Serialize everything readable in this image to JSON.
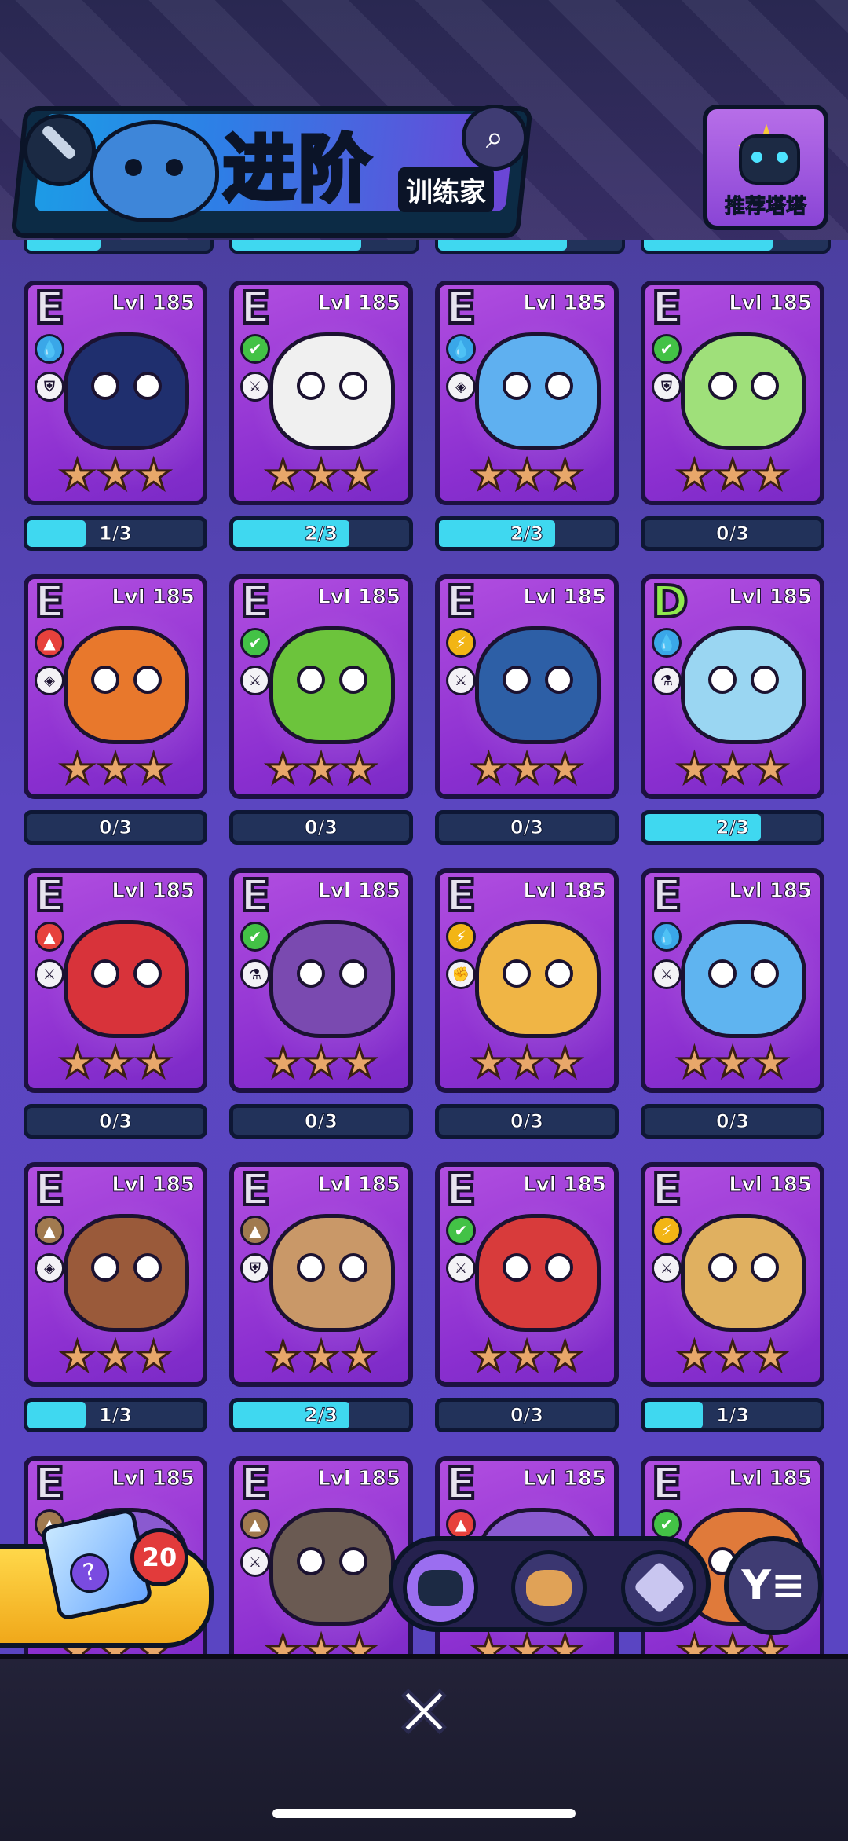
{
  "header": {
    "title": "进阶",
    "subtitle": "训练家",
    "recommend_label": "推荐塔塔"
  },
  "colors": {
    "progress_fill": "#3fd8f0",
    "card_purple": "#9b3ad8",
    "header_cyan": "#50eeff"
  },
  "cards": [
    {
      "tier": "E",
      "level": "Lvl 185",
      "element": "water-icon",
      "role": "shield-icon",
      "body": "#1f2f6e",
      "progress": "1/3",
      "fill": 0.33
    },
    {
      "tier": "E",
      "level": "Lvl 185",
      "element": "leaf-icon",
      "role": "dagger-icon",
      "body": "#f0f0f0",
      "progress": "2/3",
      "fill": 0.66
    },
    {
      "tier": "E",
      "level": "Lvl 185",
      "element": "water-icon",
      "role": "eye-icon",
      "body": "#5fb0f0",
      "progress": "2/3",
      "fill": 0.66
    },
    {
      "tier": "E",
      "level": "Lvl 185",
      "element": "leaf-icon",
      "role": "shield-icon",
      "body": "#9fe07a",
      "progress": "0/3",
      "fill": 0
    },
    {
      "tier": "E",
      "level": "Lvl 185",
      "element": "fire-icon",
      "role": "eye-icon",
      "body": "#e8782c",
      "progress": "0/3",
      "fill": 0
    },
    {
      "tier": "E",
      "level": "Lvl 185",
      "element": "leaf-icon",
      "role": "dagger-icon",
      "body": "#6cc43c",
      "progress": "0/3",
      "fill": 0
    },
    {
      "tier": "E",
      "level": "Lvl 185",
      "element": "bolt-icon",
      "role": "dagger-icon",
      "body": "#2d5fa6",
      "progress": "0/3",
      "fill": 0
    },
    {
      "tier": "D",
      "level": "Lvl 185",
      "element": "water-icon",
      "role": "flask-icon",
      "body": "#9ad6f2",
      "progress": "2/3",
      "fill": 0.66
    },
    {
      "tier": "E",
      "level": "Lvl 185",
      "element": "fire-icon",
      "role": "dagger-icon",
      "body": "#d8333a",
      "progress": "0/3",
      "fill": 0
    },
    {
      "tier": "E",
      "level": "Lvl 185",
      "element": "leaf-icon",
      "role": "flask-icon",
      "body": "#7a4ab0",
      "progress": "0/3",
      "fill": 0
    },
    {
      "tier": "E",
      "level": "Lvl 185",
      "element": "bolt-icon",
      "role": "fist-icon",
      "body": "#f0b545",
      "progress": "0/3",
      "fill": 0
    },
    {
      "tier": "E",
      "level": "Lvl 185",
      "element": "water-icon",
      "role": "dagger-icon",
      "body": "#5fb4f0",
      "progress": "0/3",
      "fill": 0
    },
    {
      "tier": "E",
      "level": "Lvl 185",
      "element": "earth-icon",
      "role": "eye-icon",
      "body": "#9a5a3a",
      "progress": "1/3",
      "fill": 0.33
    },
    {
      "tier": "E",
      "level": "Lvl 185",
      "element": "earth-icon",
      "role": "shield-icon",
      "body": "#c99868",
      "progress": "2/3",
      "fill": 0.66
    },
    {
      "tier": "E",
      "level": "Lvl 185",
      "element": "leaf-icon",
      "role": "dagger-icon",
      "body": "#d83b3b",
      "progress": "0/3",
      "fill": 0
    },
    {
      "tier": "E",
      "level": "Lvl 185",
      "element": "bolt-icon",
      "role": "dagger-icon",
      "body": "#e0b060",
      "progress": "1/3",
      "fill": 0.33
    },
    {
      "tier": "E",
      "level": "Lvl 185",
      "element": "earth-icon",
      "role": "",
      "body": "#8a5ad0",
      "progress": "",
      "fill": 0
    },
    {
      "tier": "E",
      "level": "Lvl 185",
      "element": "earth-icon",
      "role": "dagger-icon",
      "body": "#6a5a52",
      "progress": "",
      "fill": 0
    },
    {
      "tier": "E",
      "level": "Lvl 185",
      "element": "fire-icon",
      "role": "",
      "body": "#8a5ad0",
      "progress": "",
      "fill": 0
    },
    {
      "tier": "E",
      "level": "Lvl 185",
      "element": "leaf-icon",
      "role": "",
      "body": "#e07a3a",
      "progress": "",
      "fill": 0
    }
  ],
  "bottom": {
    "box_count": "20",
    "close_icon": "close-icon",
    "filter_icon": "filter-icon"
  }
}
